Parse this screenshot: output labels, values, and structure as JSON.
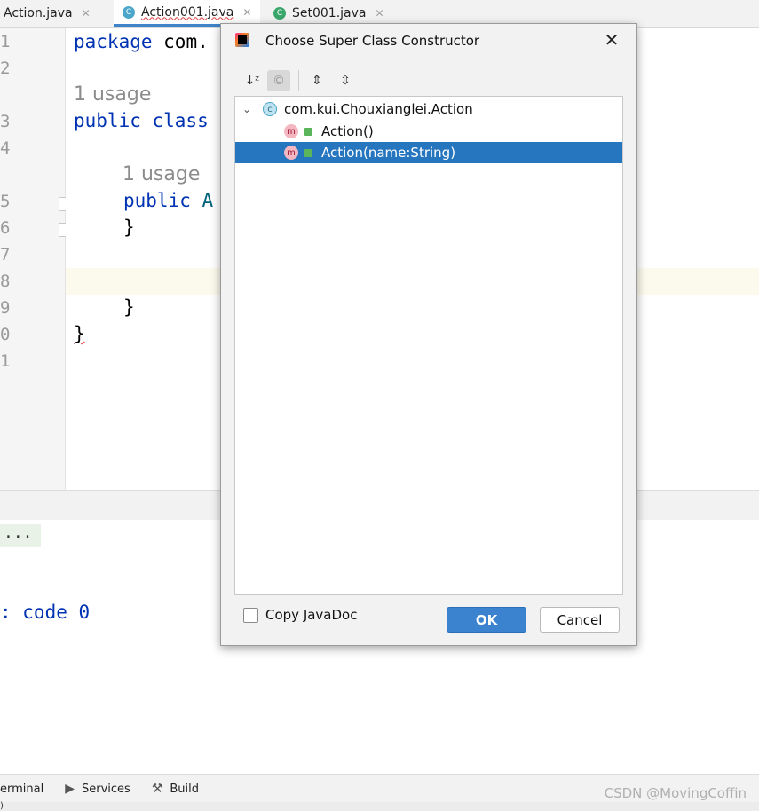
{
  "tabs": [
    {
      "label": "Action.java"
    },
    {
      "label": "Action001.java"
    },
    {
      "label": "Set001.java"
    }
  ],
  "editor": {
    "line_numbers": [
      "1",
      "2",
      "3",
      "4",
      "5",
      "6",
      "7",
      "8",
      "9",
      "0",
      "1"
    ],
    "line1": {
      "kw": "package",
      "rest": " com."
    },
    "usage1": "1 usage",
    "line3": {
      "kw1": "public",
      "kw2": " class"
    },
    "usage2": "1 usage",
    "line5": {
      "kw": "public",
      "rest": " A"
    },
    "brace_close_inner": "}",
    "brace_close_method": "}",
    "brace_close_class": "}"
  },
  "console": {
    "dots": "...",
    "exit_text": ": code 0"
  },
  "bottom_tools": [
    {
      "label": "erminal"
    },
    {
      "label": "Services"
    },
    {
      "label": "Build"
    }
  ],
  "statusbar": {
    "text": ")"
  },
  "watermark": "CSDN @MovingCoffin",
  "dialog": {
    "title": "Choose Super Class Constructor",
    "close_glyph": "✕",
    "tree": {
      "root_label": "com.kui.Chouxianglei.Action",
      "items": [
        {
          "label": "Action()",
          "selected": false
        },
        {
          "label": "Action(name:String)",
          "selected": true
        }
      ]
    },
    "copy_javadoc_label": "Copy JavaDoc",
    "copy_javadoc_checked": false,
    "ok_label": "OK",
    "cancel_label": "Cancel"
  },
  "colors": {
    "selection": "#2675bf",
    "ok_button": "#3b82cf",
    "keyword": "#0033b3"
  }
}
